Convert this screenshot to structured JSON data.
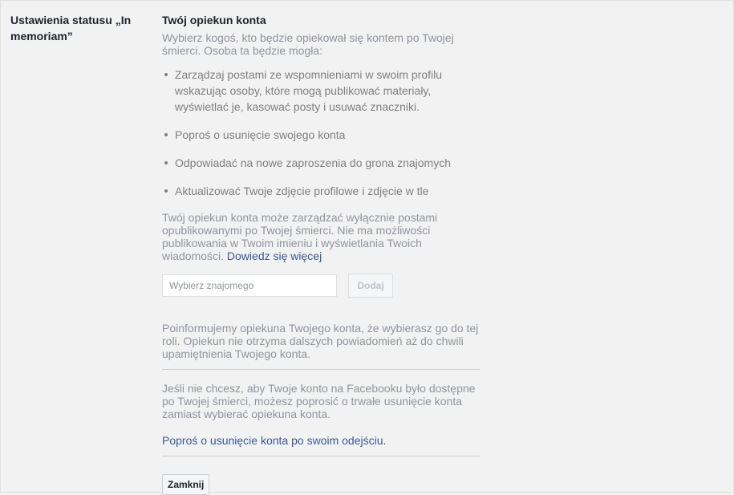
{
  "section": {
    "label": "Ustawienia statusu „In memoriam”"
  },
  "legacy_contact": {
    "title": "Twój opiekun konta",
    "intro": "Wybierz kogoś, kto będzie opiekował się kontem po Twojej śmierci. Osoba ta będzie mogła:",
    "capabilities": [
      "Zarządzaj postami ze wspomnieniami w swoim profilu wskazując osoby, które mogą publikować materiały, wyświetlać je, kasować posty i usuwać znaczniki.",
      "Poproś o usunięcie swojego konta",
      "Odpowiadać na nowe zaproszenia do grona znajomych",
      "Aktualizować Twoje zdjęcie profilowe i zdjęcie w tle"
    ],
    "limitation_text": "Twój opiekun konta może zarządzać wyłącznie postami opublikowanymi po Twojej śmierci. Nie ma możliwości publikowania w Twoim imieniu i wyświetlania Twoich wiadomości.",
    "learn_more_link": "Dowiedz się więcej",
    "friend_input": {
      "placeholder": "Wybierz znajomego",
      "value": ""
    },
    "add_button_label": "Dodaj",
    "notify_text": "Poinformujemy opiekuna Twojego konta, że wybierasz go do tej roli. Opiekun nie otrzyma dalszych powiadomień aż do chwili upamiętnienia Twojego konta.",
    "delete_info": "Jeśli nie chcesz, aby Twoje konto na Facebooku było dostępne po Twojej śmierci, możesz poprosić o trwałe usunięcie konta zamiast wybierać opiekuna konta.",
    "delete_link": "Poproś o usunięcie konta po swoim odejściu",
    "delete_link_suffix": ".",
    "close_button_label": "Zamknij"
  },
  "colors": {
    "link": "#385898",
    "muted_text": "#90949c",
    "background": "#f2f2f2"
  }
}
